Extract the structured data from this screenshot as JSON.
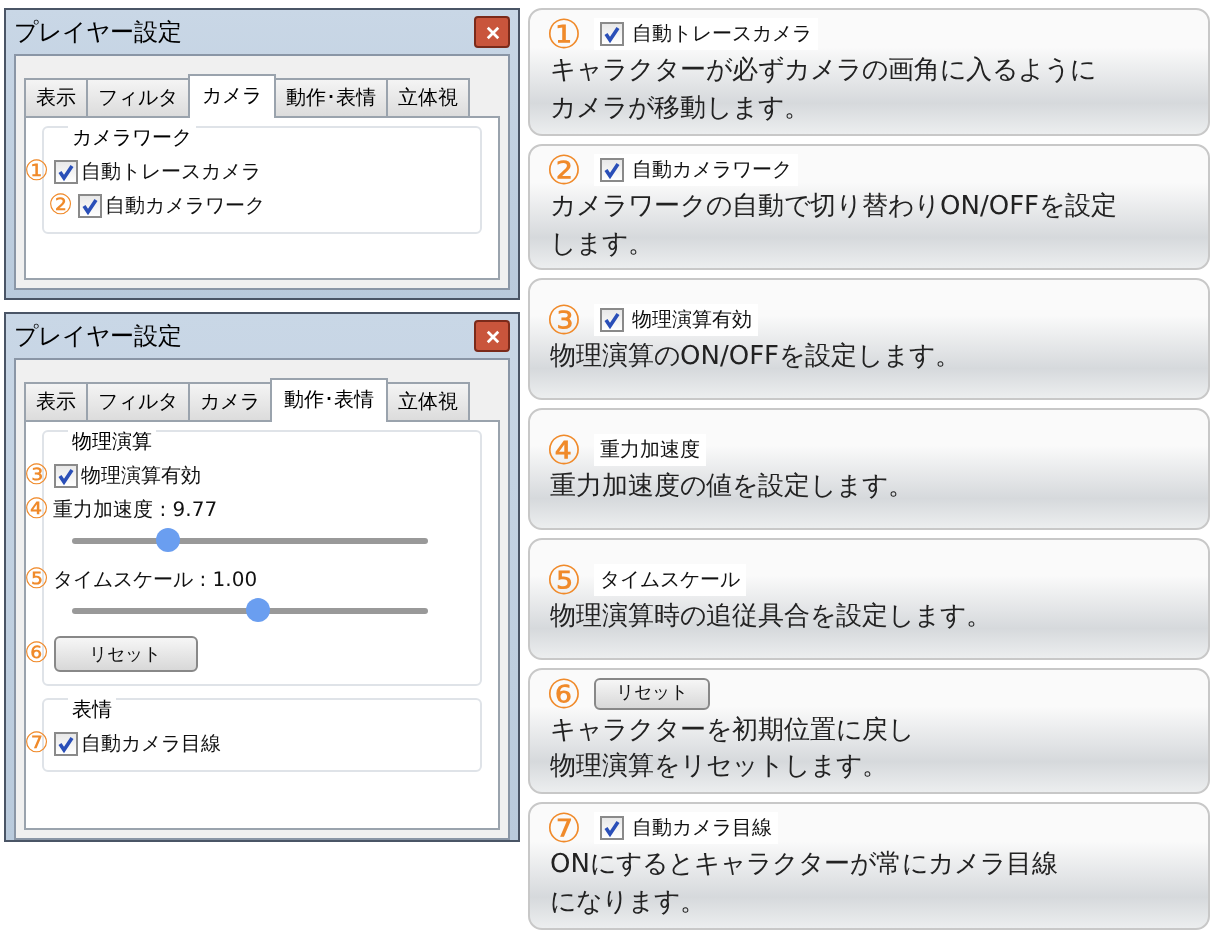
{
  "dialogs": [
    {
      "title": "プレイヤー設定",
      "tabs": [
        {
          "label": "表示",
          "selected": false
        },
        {
          "label": "フィルタ",
          "selected": false
        },
        {
          "label": "カメラ",
          "selected": true
        },
        {
          "label": "動作･表情",
          "selected": false
        },
        {
          "label": "立体視",
          "selected": false
        }
      ],
      "groups": [
        {
          "title": "カメラワーク",
          "items": [
            {
              "kind": "checkbox",
              "marker": "①",
              "label": "自動トレースカメラ",
              "checked": true
            },
            {
              "kind": "checkbox",
              "marker": "②",
              "label": "自動カメラワーク",
              "checked": true
            }
          ]
        }
      ]
    },
    {
      "title": "プレイヤー設定",
      "tabs": [
        {
          "label": "表示",
          "selected": false
        },
        {
          "label": "フィルタ",
          "selected": false
        },
        {
          "label": "カメラ",
          "selected": false
        },
        {
          "label": "動作･表情",
          "selected": true
        },
        {
          "label": "立体視",
          "selected": false
        }
      ],
      "groups": [
        {
          "title": "物理演算",
          "items": [
            {
              "kind": "checkbox",
              "marker": "③",
              "label": "物理演算有効",
              "checked": true
            },
            {
              "kind": "slider",
              "marker": "④",
              "label": "重力加速度 : 9.77",
              "level": 0.27
            },
            {
              "kind": "slider",
              "marker": "⑤",
              "label": "タイムスケール : 1.00",
              "level": 0.52
            },
            {
              "kind": "button",
              "marker": "⑥",
              "label": "リセット"
            }
          ]
        },
        {
          "title": "表情",
          "items": [
            {
              "kind": "checkbox",
              "marker": "⑦",
              "label": "自動カメラ目線",
              "checked": true
            }
          ]
        }
      ]
    }
  ],
  "notes": [
    {
      "marker": "①",
      "kind": "checkbox",
      "label": "自動トレースカメラ",
      "checked": true,
      "lines": [
        "キャラクターが必ずカメラの画角に入るように",
        "カメラが移動します。"
      ]
    },
    {
      "marker": "②",
      "kind": "checkbox",
      "label": "自動カメラワーク",
      "checked": true,
      "lines": [
        "カメラワークの自動で切り替わりON/OFFを設定",
        "します。"
      ]
    },
    {
      "marker": "③",
      "kind": "checkbox",
      "label": "物理演算有効",
      "checked": true,
      "lines": [
        "物理演算のON/OFFを設定します。"
      ]
    },
    {
      "marker": "④",
      "kind": "label",
      "label": "重力加速度",
      "lines": [
        "重力加速度の値を設定します。"
      ]
    },
    {
      "marker": "⑤",
      "kind": "label",
      "label": "タイムスケール",
      "lines": [
        "物理演算時の追従具合を設定します。"
      ]
    },
    {
      "marker": "⑥",
      "kind": "button",
      "label": "リセット",
      "lines": [
        "キャラクターを初期位置に戻し",
        "物理演算をリセットします。"
      ]
    },
    {
      "marker": "⑦",
      "kind": "checkbox",
      "label": "自動カメラ目線",
      "checked": true,
      "lines": [
        "ONにするとキャラクターが常にカメラ目線",
        "になります。"
      ]
    }
  ]
}
